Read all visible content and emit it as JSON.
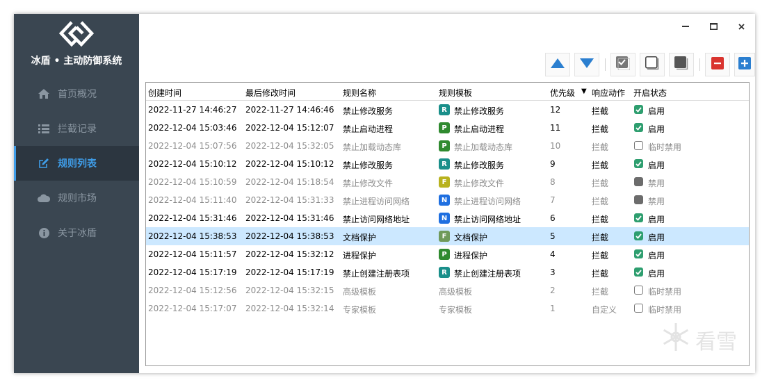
{
  "app": {
    "title": "冰盾 • 主动防御系统"
  },
  "sidebar": {
    "items": [
      {
        "label": "首页概况",
        "icon": "home-icon",
        "active": false
      },
      {
        "label": "拦截记录",
        "icon": "list-icon",
        "active": false
      },
      {
        "label": "规则列表",
        "icon": "edit-icon",
        "active": true
      },
      {
        "label": "规则市场",
        "icon": "cloud-icon",
        "active": false
      },
      {
        "label": "关于冰盾",
        "icon": "info-icon",
        "active": false
      }
    ]
  },
  "window_controls": {
    "minimize": "–",
    "maximize": "☐",
    "close": "×"
  },
  "toolbar": {
    "buttons": [
      "move-up",
      "move-down",
      "enable-all",
      "temp-disable-all",
      "disable-all",
      "delete",
      "add"
    ]
  },
  "table": {
    "headers": {
      "created": "创建时间",
      "modified": "最后修改时间",
      "name": "规则名称",
      "template": "规则模板",
      "priority": "优先级",
      "action": "响应动作",
      "status": "开启状态"
    },
    "sort_indicator": "▼",
    "rows": [
      {
        "created": "2022-11-27 14:46:27",
        "modified": "2022-11-27 14:46:46",
        "name": "禁止修改服务",
        "badge": "R",
        "template": "禁止修改服务",
        "priority": "12",
        "action": "拦截",
        "status": "启用",
        "state": "on"
      },
      {
        "created": "2022-12-04 15:03:46",
        "modified": "2022-12-04 15:12:07",
        "name": "禁止启动进程",
        "badge": "P",
        "template": "禁止启动进程",
        "priority": "11",
        "action": "拦截",
        "status": "启用",
        "state": "on"
      },
      {
        "created": "2022-12-04 15:07:56",
        "modified": "2022-12-04 15:32:05",
        "name": "禁止加载动态库",
        "badge": "P",
        "template": "禁止加载动态库",
        "priority": "10",
        "action": "拦截",
        "status": "临时禁用",
        "state": "temp"
      },
      {
        "created": "2022-12-04 15:10:12",
        "modified": "2022-12-04 15:10:12",
        "name": "禁止修改服务",
        "badge": "R",
        "template": "禁止修改服务",
        "priority": "9",
        "action": "拦截",
        "status": "启用",
        "state": "on"
      },
      {
        "created": "2022-12-04 15:10:59",
        "modified": "2022-12-04 15:18:54",
        "name": "禁止修改文件",
        "badge": "F",
        "template": "禁止修改文件",
        "priority": "8",
        "action": "拦截",
        "status": "禁用",
        "state": "off"
      },
      {
        "created": "2022-12-04 15:11:40",
        "modified": "2022-12-04 15:31:33",
        "name": "禁止进程访问网络",
        "badge": "N",
        "template": "禁止进程访问网络",
        "priority": "7",
        "action": "拦截",
        "status": "禁用",
        "state": "off"
      },
      {
        "created": "2022-12-04 15:31:46",
        "modified": "2022-12-04 15:31:46",
        "name": "禁止访问网络地址",
        "badge": "N",
        "template": "禁止访问网络地址",
        "priority": "6",
        "action": "拦截",
        "status": "启用",
        "state": "on"
      },
      {
        "created": "2022-12-04 15:38:53",
        "modified": "2022-12-04 15:38:53",
        "name": "文档保护",
        "badge": "F",
        "template": "文档保护",
        "priority": "5",
        "action": "拦截",
        "status": "启用",
        "state": "on",
        "selected": true
      },
      {
        "created": "2022-12-04 15:11:57",
        "modified": "2022-12-04 15:32:12",
        "name": "进程保护",
        "badge": "P",
        "template": "进程保护",
        "priority": "4",
        "action": "拦截",
        "status": "启用",
        "state": "on"
      },
      {
        "created": "2022-12-04 15:17:19",
        "modified": "2022-12-04 15:17:19",
        "name": "禁止创建注册表项",
        "badge": "R",
        "template": "禁止创建注册表项",
        "priority": "3",
        "action": "拦截",
        "status": "启用",
        "state": "on"
      },
      {
        "created": "2022-12-04 15:12:56",
        "modified": "2022-12-04 15:32:15",
        "name": "高级模板",
        "badge": "",
        "template": "高级模板",
        "priority": "2",
        "action": "拦截",
        "status": "临时禁用",
        "state": "temp"
      },
      {
        "created": "2022-12-04 15:17:07",
        "modified": "2022-12-04 15:32:14",
        "name": "专家模板",
        "badge": "",
        "template": "专家模板",
        "priority": "1",
        "action": "自定义",
        "status": "临时禁用",
        "state": "temp"
      }
    ]
  },
  "badge_colors": {
    "R": "#1a8f8a",
    "P": "#2f8a2f",
    "F": "#b8b21e",
    "F_selected": "#6f9a5a",
    "N": "#1f6fe0"
  },
  "colors": {
    "sidebar_bg": "#3a4651",
    "accent": "#3f9de8",
    "selected_row": "#cce8ff",
    "checked": "#2e9e6f",
    "delete": "#d9342f",
    "add": "#2b7fd0",
    "arrow": "#2b7fd0"
  },
  "watermark": {
    "text": "看雪"
  }
}
